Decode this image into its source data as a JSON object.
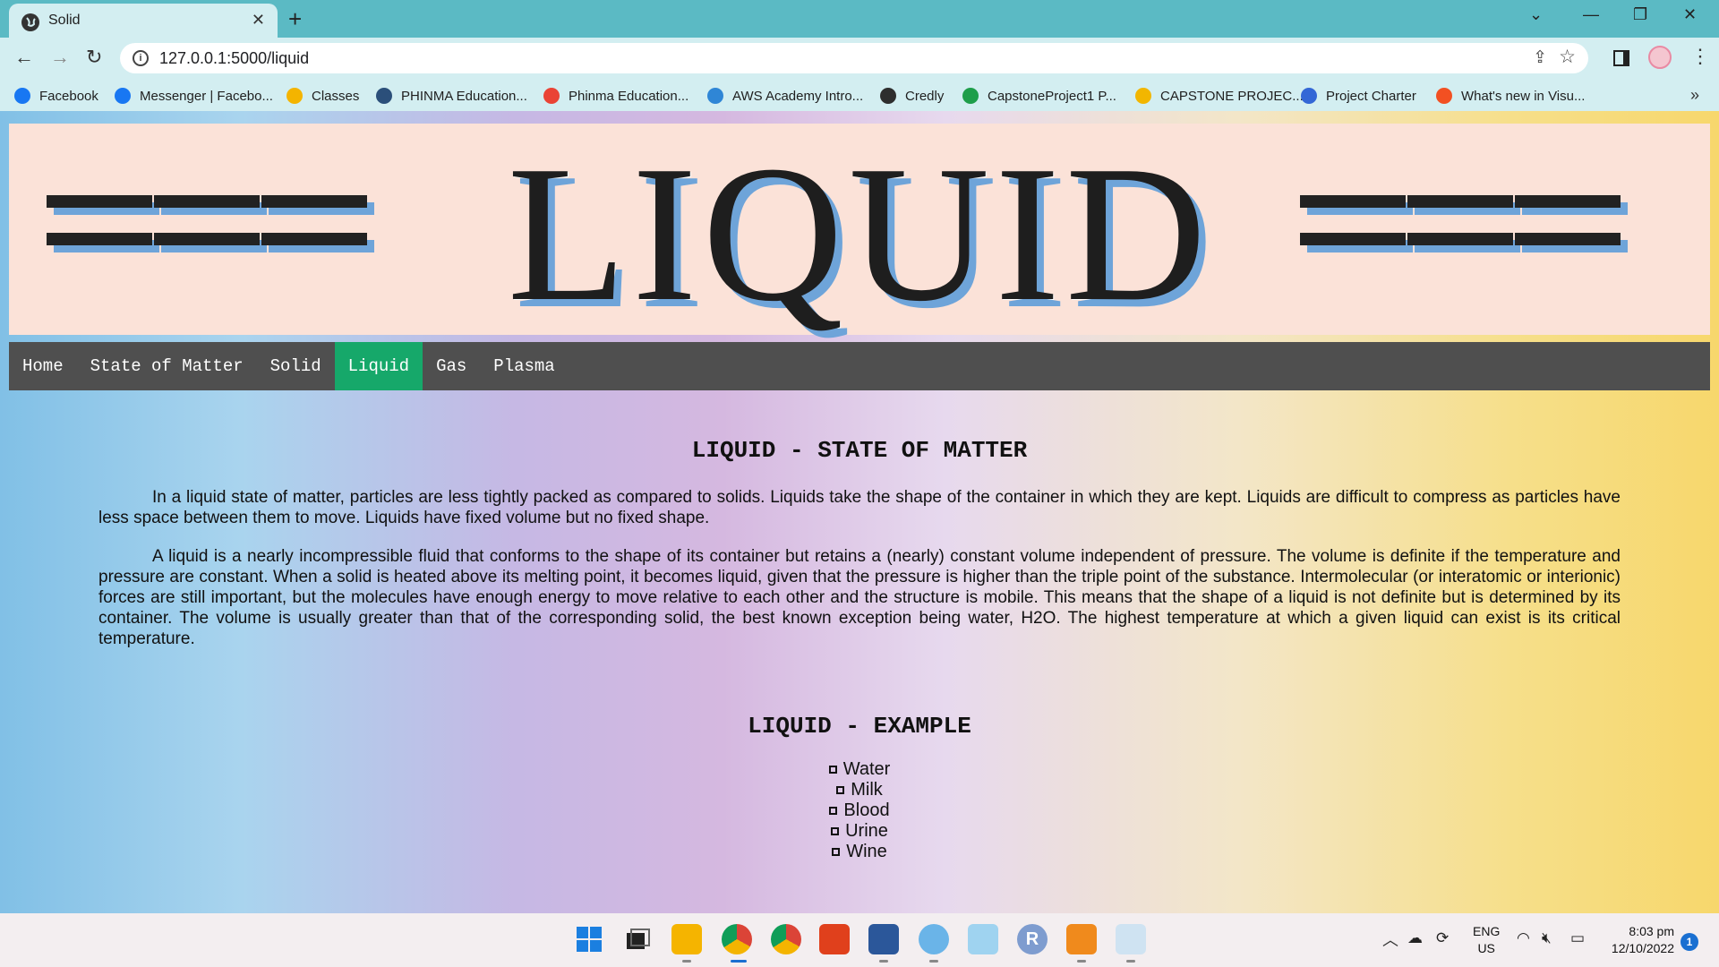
{
  "browser": {
    "tab_title": "Solid",
    "url": "127.0.0.1:5000/liquid",
    "bookmarks": [
      {
        "label": "Facebook",
        "icon": "facebook-icon",
        "color": "#1877f2"
      },
      {
        "label": "Messenger | Facebo...",
        "icon": "facebook-icon",
        "color": "#1877f2"
      },
      {
        "label": "Classes",
        "icon": "classroom-icon",
        "color": "#f4b400"
      },
      {
        "label": "PHINMA Education...",
        "icon": "globe-icon",
        "color": "#2b4f7a"
      },
      {
        "label": "Phinma Education...",
        "icon": "gmail-icon",
        "color": "#ea4335"
      },
      {
        "label": "AWS Academy Intro...",
        "icon": "cloud-icon",
        "color": "#2f86d6"
      },
      {
        "label": "Credly",
        "icon": "credly-icon",
        "color": "#2e2e2e"
      },
      {
        "label": "CapstoneProject1 P...",
        "icon": "sheets-icon",
        "color": "#1e9e4a"
      },
      {
        "label": "CAPSTONE PROJEC...",
        "icon": "drive-icon",
        "color": "#f2b600"
      },
      {
        "label": "Project Charter",
        "icon": "contacts-icon",
        "color": "#3367d6"
      },
      {
        "label": "What's new in Visu...",
        "icon": "microsoft-icon",
        "color": "#f25022"
      }
    ]
  },
  "banner": {
    "title": "LIQUID"
  },
  "nav": {
    "items": [
      "Home",
      "State of Matter",
      "Solid",
      "Liquid",
      "Gas",
      "Plasma"
    ],
    "active": "Liquid",
    "active_color": "#16a86a"
  },
  "content": {
    "heading1": "LIQUID - STATE OF MATTER",
    "paragraph1": "In a liquid state of matter, particles are less tightly packed as compared to solids. Liquids take the shape of the container in which they are kept. Liquids are difficult to compress as particles have less space between them to move. Liquids have fixed volume but no fixed shape.",
    "paragraph2": "A liquid is a nearly incompressible fluid that conforms to the shape of its container but retains a (nearly) constant volume independent of pressure. The volume is definite if the temperature and pressure are constant. When a solid is heated above its melting point, it becomes liquid, given that the pressure is higher than the triple point of the substance. Intermolecular (or interatomic or interionic) forces are still important, but the molecules have enough energy to move relative to each other and the structure is mobile. This means that the shape of a liquid is not definite but is determined by its container. The volume is usually greater than that of the corresponding solid, the best known exception being water, H2O. The highest temperature at which a given liquid can exist is its critical temperature.",
    "heading2": "LIQUID - EXAMPLE",
    "examples": [
      "Water",
      "Milk",
      "Blood",
      "Urine",
      "Wine"
    ]
  },
  "taskbar": {
    "language": "ENG",
    "region": "US",
    "time": "8:03 pm",
    "date": "12/10/2022",
    "notification_count": "1"
  }
}
